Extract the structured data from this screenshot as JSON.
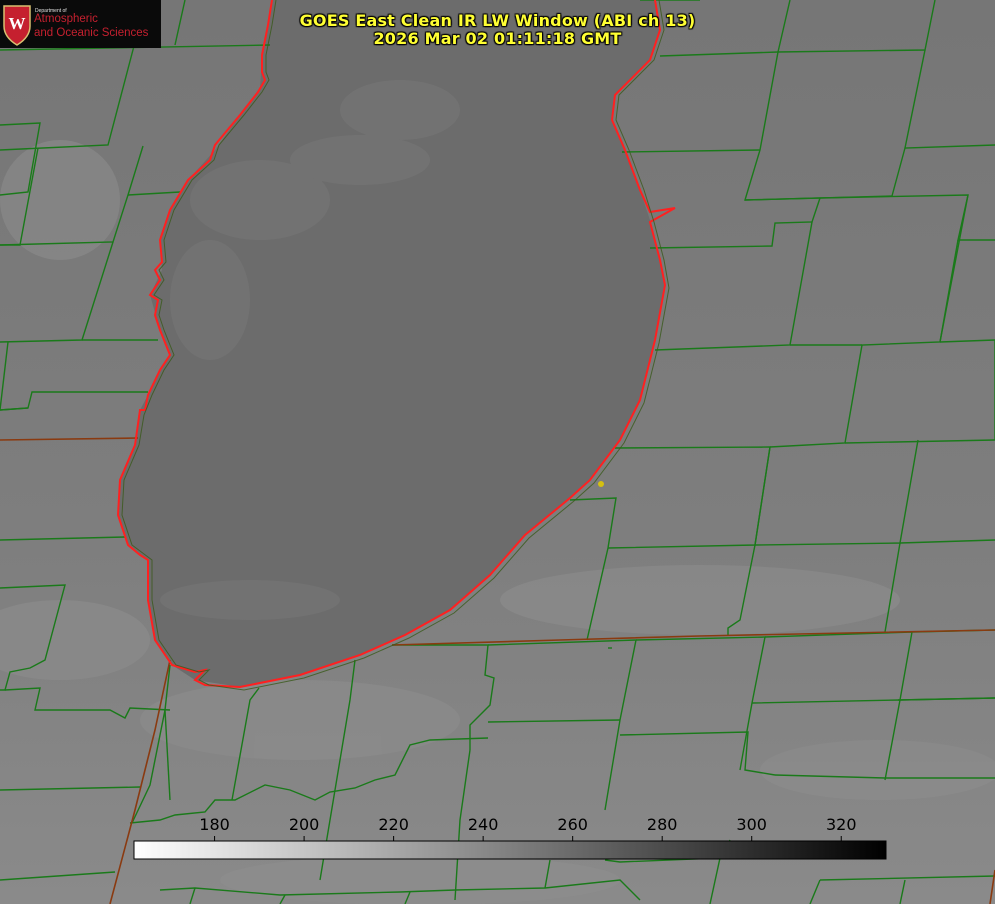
{
  "title": {
    "line1": "GOES East Clean IR LW Window (ABI ch 13)",
    "line2": "2026 Mar 02 01:11:18 GMT"
  },
  "logo": {
    "dept_small": "Department of",
    "line1": "Atmospheric",
    "line2": "and Oceanic Sciences",
    "crest_letter": "W",
    "colors": {
      "crest": "#c5202f",
      "text": "#c5202f"
    }
  },
  "colorbar": {
    "range": [
      162,
      330
    ],
    "ticks": [
      {
        "value": 180,
        "label": "180"
      },
      {
        "value": 200,
        "label": "200"
      },
      {
        "value": 220,
        "label": "220"
      },
      {
        "value": 240,
        "label": "240"
      },
      {
        "value": 260,
        "label": "260"
      },
      {
        "value": 280,
        "label": "280"
      },
      {
        "value": 300,
        "label": "300"
      },
      {
        "value": 320,
        "label": "320"
      }
    ],
    "gradient": {
      "cold": "#ffffff",
      "warm": "#000000"
    }
  },
  "map_colors": {
    "county_lines": "#1a7a1a",
    "state_lines": "#8a3a10",
    "lake_outline": "#ff2020",
    "marker": "#d4c010",
    "lake_fill": "#6a6a6a",
    "land_fill": "#7d7d7d"
  }
}
